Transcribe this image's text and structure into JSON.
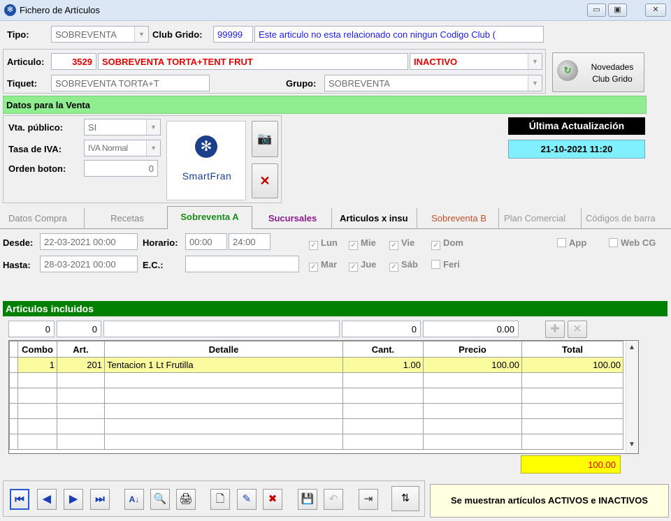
{
  "window": {
    "title": "Fichero de Artículos",
    "min": "▭",
    "max": "▣",
    "close": "✕"
  },
  "header": {
    "tipo_label": "Tipo:",
    "tipo_value": "SOBREVENTA",
    "club_label": "Club Grido:",
    "club_code": "99999",
    "club_desc": "Este articulo no esta relacionado con ningun Codigo Club (",
    "articulo_label": "Articulo:",
    "articulo_code": "3529",
    "articulo_name": "SOBREVENTA TORTA+TENT FRUT",
    "estado": "INACTIVO",
    "tiquet_label": "Tiquet:",
    "tiquet_value": "SOBREVENTA TORTA+T",
    "grupo_label": "Grupo:",
    "grupo_value": "SOBREVENTA",
    "novedades_label": "Novedades Club Grido"
  },
  "venta": {
    "section_title": "Datos para la Venta",
    "vta_publico_label": "Vta. público:",
    "vta_publico_value": "SI",
    "iva_label": "Tasa de IVA:",
    "iva_value": "IVA Normal",
    "orden_label": "Orden boton:",
    "orden_value": "0",
    "logo_text": "SmartFran",
    "ultima_label": "Última Actualización",
    "ultima_value": "21-10-2021 11:20"
  },
  "tabs": [
    "Datos Compra",
    "Recetas",
    "Sobreventa A",
    "Sucursales",
    "Articulos x insu",
    "Sobreventa B",
    "Plan Comercial",
    "Códigos de barra"
  ],
  "sobreventa": {
    "desde_label": "Desde:",
    "desde_value": "22-03-2021 00:00",
    "hasta_label": "Hasta:",
    "hasta_value": "28-03-2021 00:00",
    "horario_label": "Horario:",
    "horario_from": "00:00",
    "horario_to": "24:00",
    "ec_label": "E.C.:",
    "ec_value": "",
    "days_row1": [
      "Lun",
      "Mie",
      "Vie",
      "Dom"
    ],
    "days_row2": [
      "Mar",
      "Jue",
      "Sáb",
      "Feri"
    ],
    "app_label": "App",
    "webcg_label": "Web CG"
  },
  "incluidos": {
    "title": "Articulos incluidos",
    "edit_combo": "0",
    "edit_art": "0",
    "edit_detalle": "",
    "edit_cant": "0",
    "edit_precio": "0.00",
    "columns": [
      "Combo",
      "Art.",
      "Detalle",
      "Cant.",
      "Precio",
      "Total"
    ],
    "rows": [
      {
        "combo": "1",
        "art": "201",
        "detalle": "Tentacion 1 Lt Frutilla",
        "cant": "1.00",
        "precio": "100.00",
        "total": "100.00"
      }
    ],
    "sum_total": "100.00"
  },
  "status": {
    "message": "Se muestran artículos ACTIVOS e INACTIVOS"
  }
}
